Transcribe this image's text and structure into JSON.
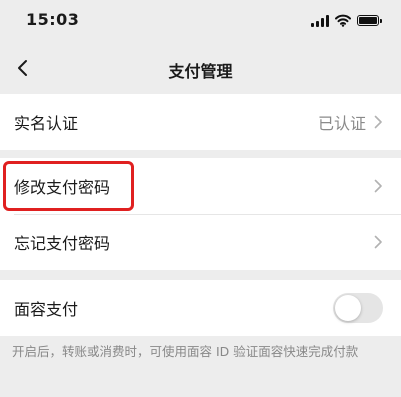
{
  "status_bar": {
    "time": "15:03"
  },
  "nav": {
    "title": "支付管理"
  },
  "rows": {
    "real_name": {
      "label": "实名认证",
      "value": "已认证"
    },
    "change_password": {
      "label": "修改支付密码"
    },
    "forgot_password": {
      "label": "忘记支付密码"
    },
    "face_pay": {
      "label": "面容支付",
      "toggle_on": false
    }
  },
  "hint": {
    "text": "开启后，转账或消费时，可使用面容 ID 验证面容快速完成付款"
  },
  "colors": {
    "highlight": "#e02020",
    "background": "#ededed",
    "secondary_text": "#8a8a8a"
  }
}
